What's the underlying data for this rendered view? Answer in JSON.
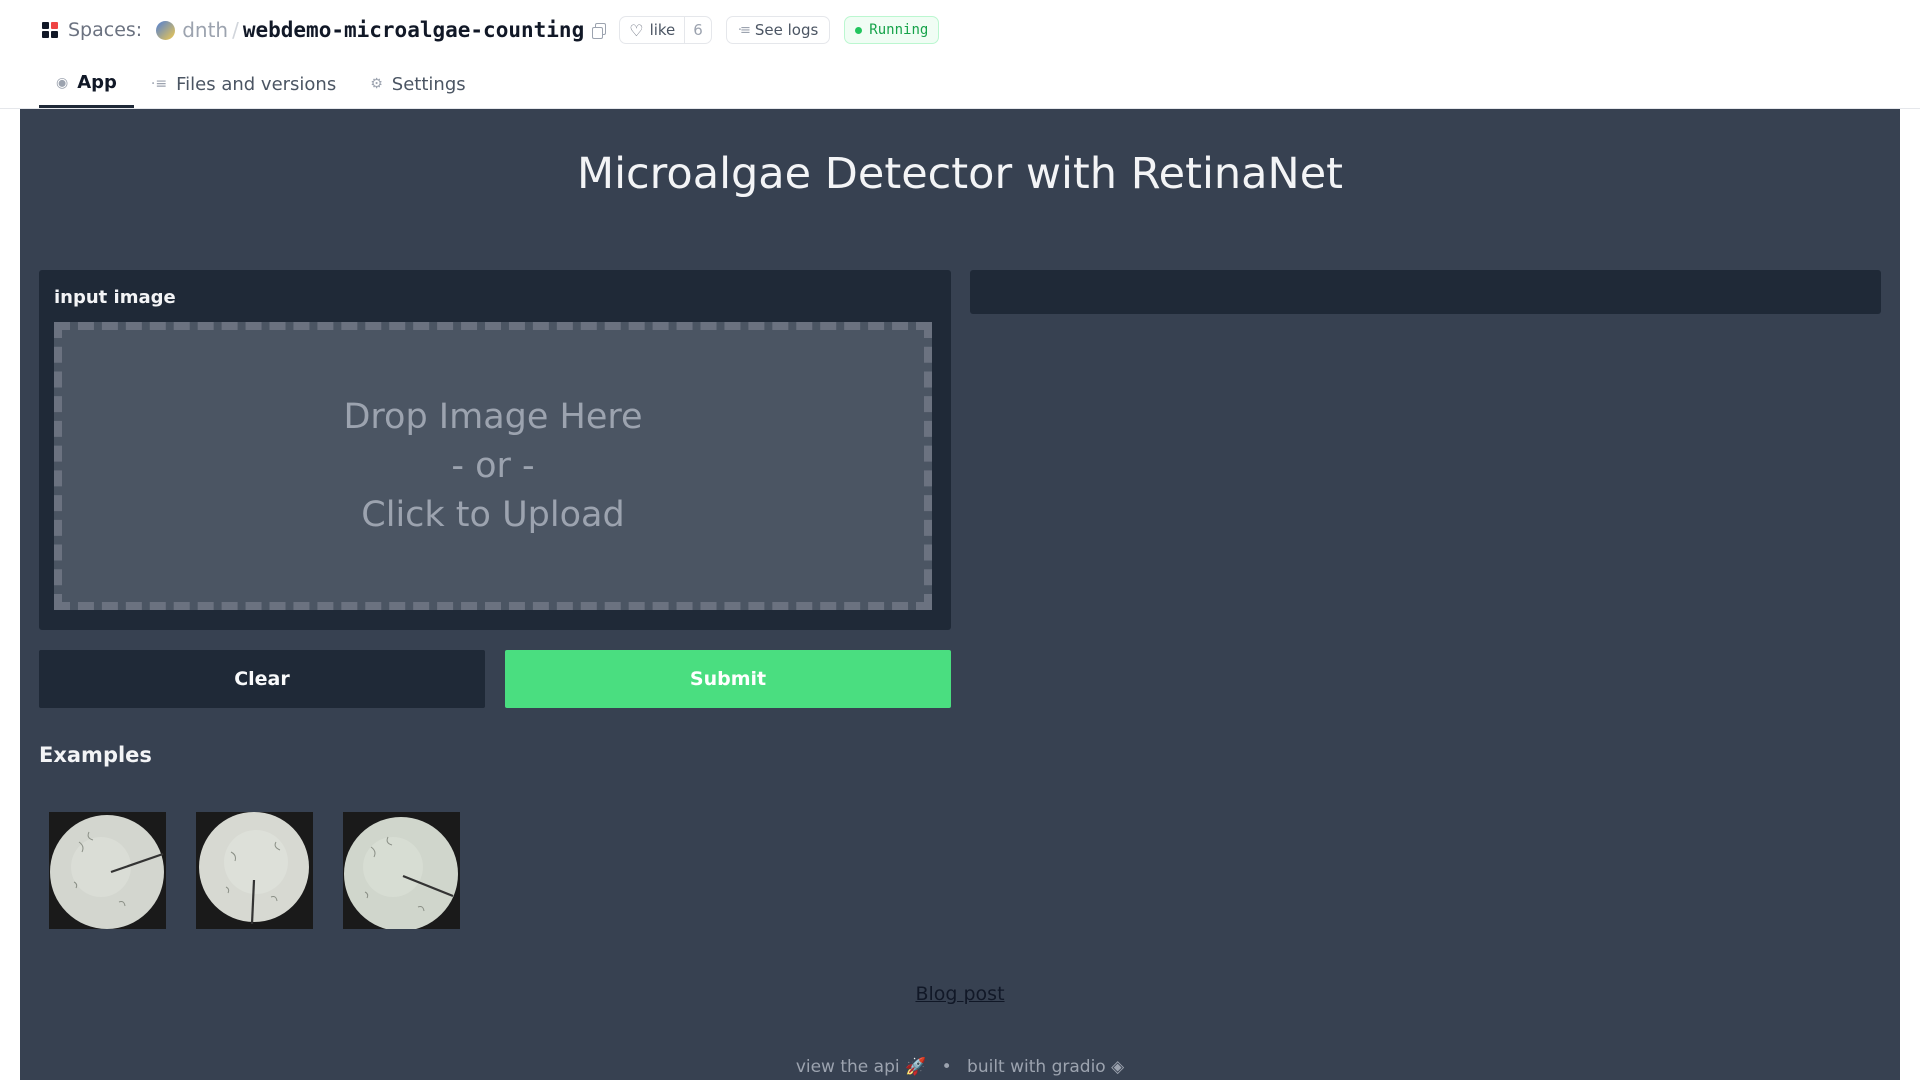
{
  "header": {
    "spaces_label": "Spaces:",
    "owner": "dnth",
    "separator": "/",
    "repo_name": "webdemo-microalgae-counting",
    "like_label": "like",
    "like_count": "6",
    "logs_label": "See logs",
    "status_label": "Running",
    "status_color": "#22c55e"
  },
  "tabs": [
    {
      "label": "App",
      "icon": "app-icon"
    },
    {
      "label": "Files and versions",
      "icon": "files-icon"
    },
    {
      "label": "Settings",
      "icon": "gear-icon"
    }
  ],
  "app": {
    "title": "Microalgae Detector with RetinaNet",
    "input_label": "input image",
    "dropzone": {
      "line1": "Drop Image Here",
      "line2": "- or -",
      "line3": "Click to Upload"
    },
    "clear_label": "Clear",
    "submit_label": "Submit",
    "submit_color": "#4ade80",
    "examples_title": "Examples",
    "examples": [
      {
        "name": "example-image-1"
      },
      {
        "name": "example-image-2"
      },
      {
        "name": "example-image-3"
      }
    ],
    "blog_link": "Blog post",
    "footer": {
      "api_text": "view the api",
      "separator": "•",
      "built_text": "built with gradio"
    }
  }
}
